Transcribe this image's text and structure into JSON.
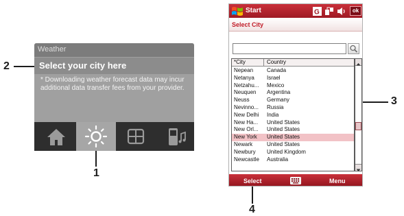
{
  "callouts": {
    "n1": "1",
    "n2": "2",
    "n3": "3",
    "n4": "4"
  },
  "weather": {
    "header": "Weather",
    "title": "Select your city here",
    "note": "* Downloading weather forecast data may incur additional data transfer fees from your provider.",
    "tabs": [
      {
        "icon": "home-icon",
        "active": false
      },
      {
        "icon": "sun-icon",
        "active": true
      },
      {
        "icon": "grid-icon",
        "active": false
      },
      {
        "icon": "phone-music-icon",
        "active": false
      }
    ]
  },
  "device": {
    "titlebar": {
      "start": "Start",
      "ok": "ok",
      "status_icons": [
        "signal-icon",
        "connectivity-icon",
        "volume-icon"
      ]
    },
    "page_title": "Select City",
    "search": {
      "value": "",
      "placeholder": ""
    },
    "table": {
      "headers": {
        "city": "*City",
        "country": "Country"
      },
      "rows": [
        {
          "city": "Nepean",
          "country": "Canada"
        },
        {
          "city": "Netanya",
          "country": "Israel"
        },
        {
          "city": "Netzahu...",
          "country": "Mexico"
        },
        {
          "city": "Neuquen",
          "country": "Argentina"
        },
        {
          "city": "Neuss",
          "country": "Germany"
        },
        {
          "city": "Nevinno...",
          "country": "Russia"
        },
        {
          "city": "New Delhi",
          "country": "India"
        },
        {
          "city": "New Ha...",
          "country": "United States"
        },
        {
          "city": "New Orl...",
          "country": "United States"
        },
        {
          "city": "New York",
          "country": "United States",
          "selected": true
        },
        {
          "city": "Newark",
          "country": "United States"
        },
        {
          "city": "Newbury",
          "country": "United Kingdom"
        },
        {
          "city": "Newcastle",
          "country": "Australia"
        }
      ]
    },
    "softkeys": {
      "left": "Select",
      "right": "Menu"
    }
  },
  "colors": {
    "accent": "#c11b27",
    "selection": "#f2c2c6"
  }
}
